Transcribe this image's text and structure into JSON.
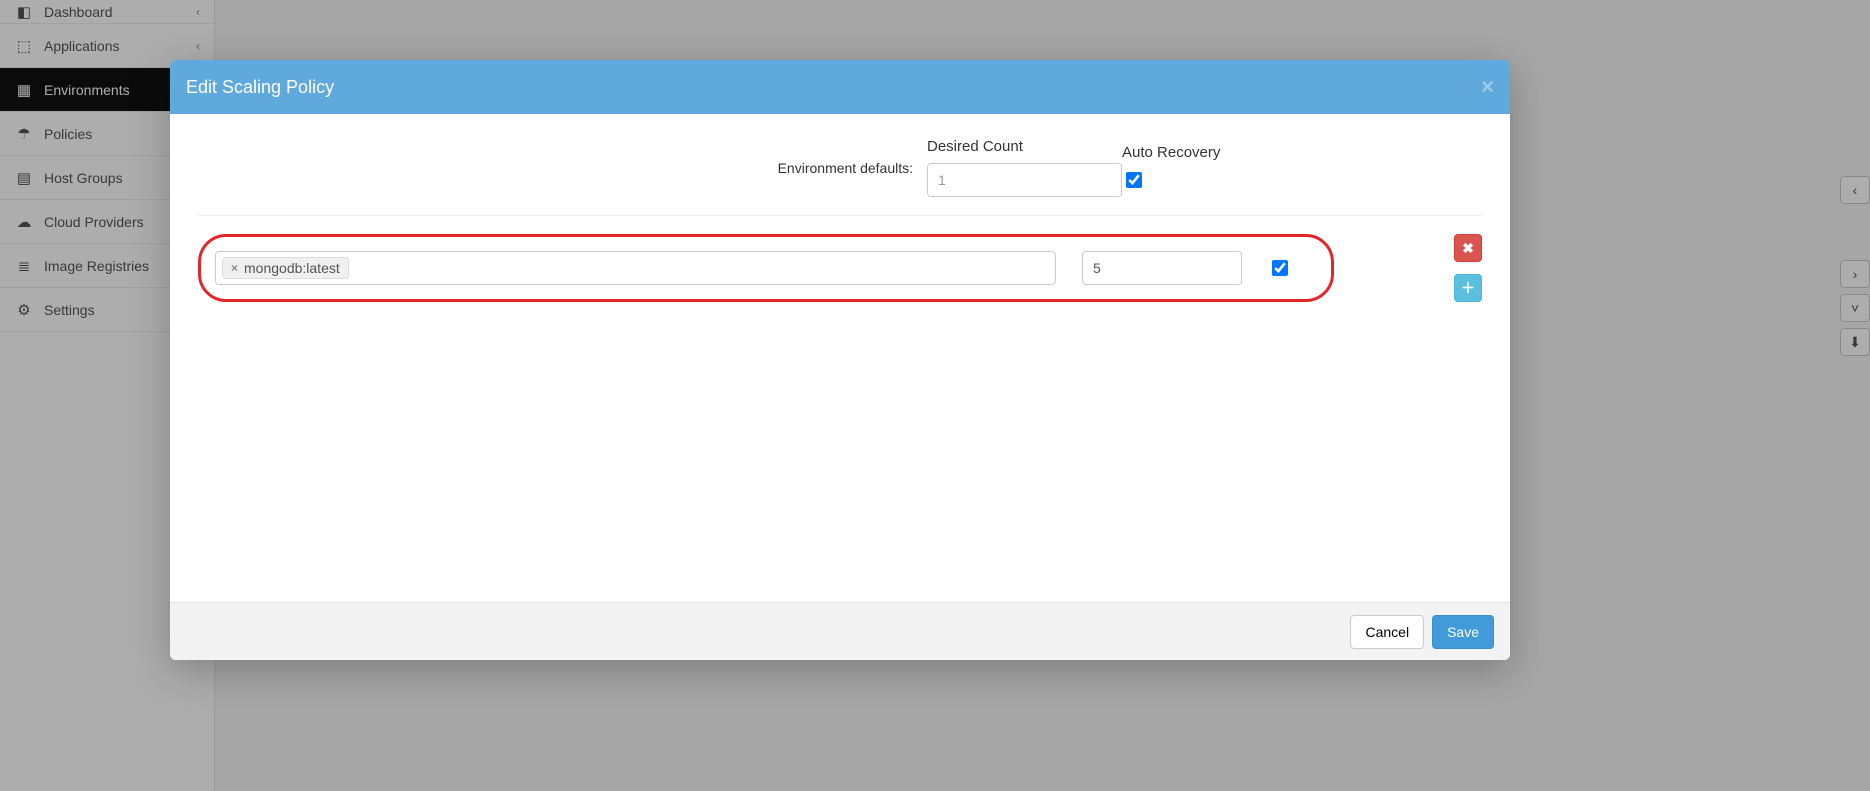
{
  "sidebar": {
    "items": [
      {
        "label": "Dashboard",
        "icon": "◧",
        "chev": true
      },
      {
        "label": "Applications",
        "icon": "⬚",
        "chev": true
      },
      {
        "label": "Environments",
        "icon": "▦",
        "active": true
      },
      {
        "label": "Policies",
        "icon": "☂"
      },
      {
        "label": "Host Groups",
        "icon": "▤"
      },
      {
        "label": "Cloud Providers",
        "icon": "☁"
      },
      {
        "label": "Image Registries",
        "icon": "≣"
      },
      {
        "label": "Settings",
        "icon": "⚙"
      }
    ]
  },
  "modal": {
    "title": "Edit Scaling Policy",
    "defaults_label": "Environment defaults:",
    "columns": {
      "count": "Desired Count",
      "auto": "Auto Recovery"
    },
    "defaults": {
      "count": "1",
      "auto": true
    },
    "rule": {
      "tag": "mongodb:latest",
      "count": "5",
      "auto": true
    },
    "buttons": {
      "cancel": "Cancel",
      "save": "Save"
    }
  }
}
